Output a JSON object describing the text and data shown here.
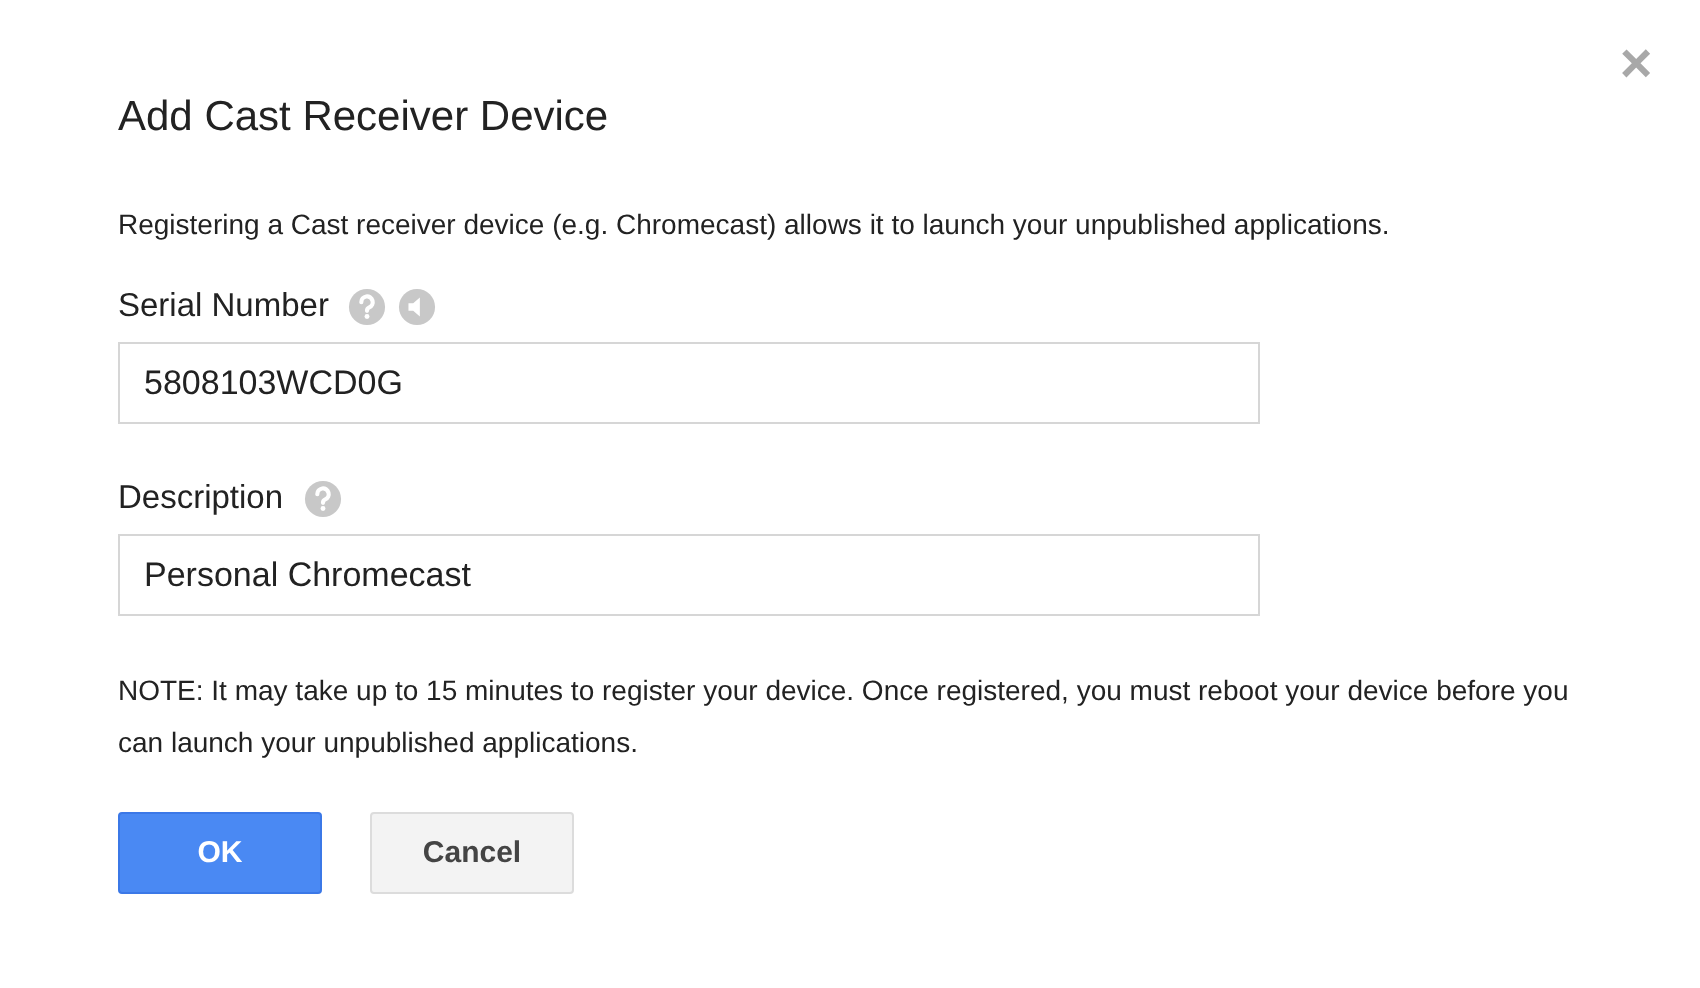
{
  "dialog": {
    "title": "Add Cast Receiver Device",
    "close": "×",
    "intro": "Registering a Cast receiver device (e.g. Chromecast) allows it to launch your unpublished applications.",
    "fields": [
      {
        "label": "Serial Number",
        "value": "5808103WCD0G",
        "icons": [
          {
            "kind": "help"
          },
          {
            "kind": "audio"
          }
        ]
      },
      {
        "label": "Description",
        "value": "Personal Chromecast",
        "icons": [
          {
            "kind": "help"
          }
        ]
      }
    ],
    "note": "NOTE: It may take up to 15 minutes to register your device. Once registered, you must reboot your device before you can launch your unpublished applications.",
    "buttons": [
      {
        "label": "OK",
        "kind": "primary"
      },
      {
        "label": "Cancel",
        "kind": "secondary"
      }
    ]
  }
}
